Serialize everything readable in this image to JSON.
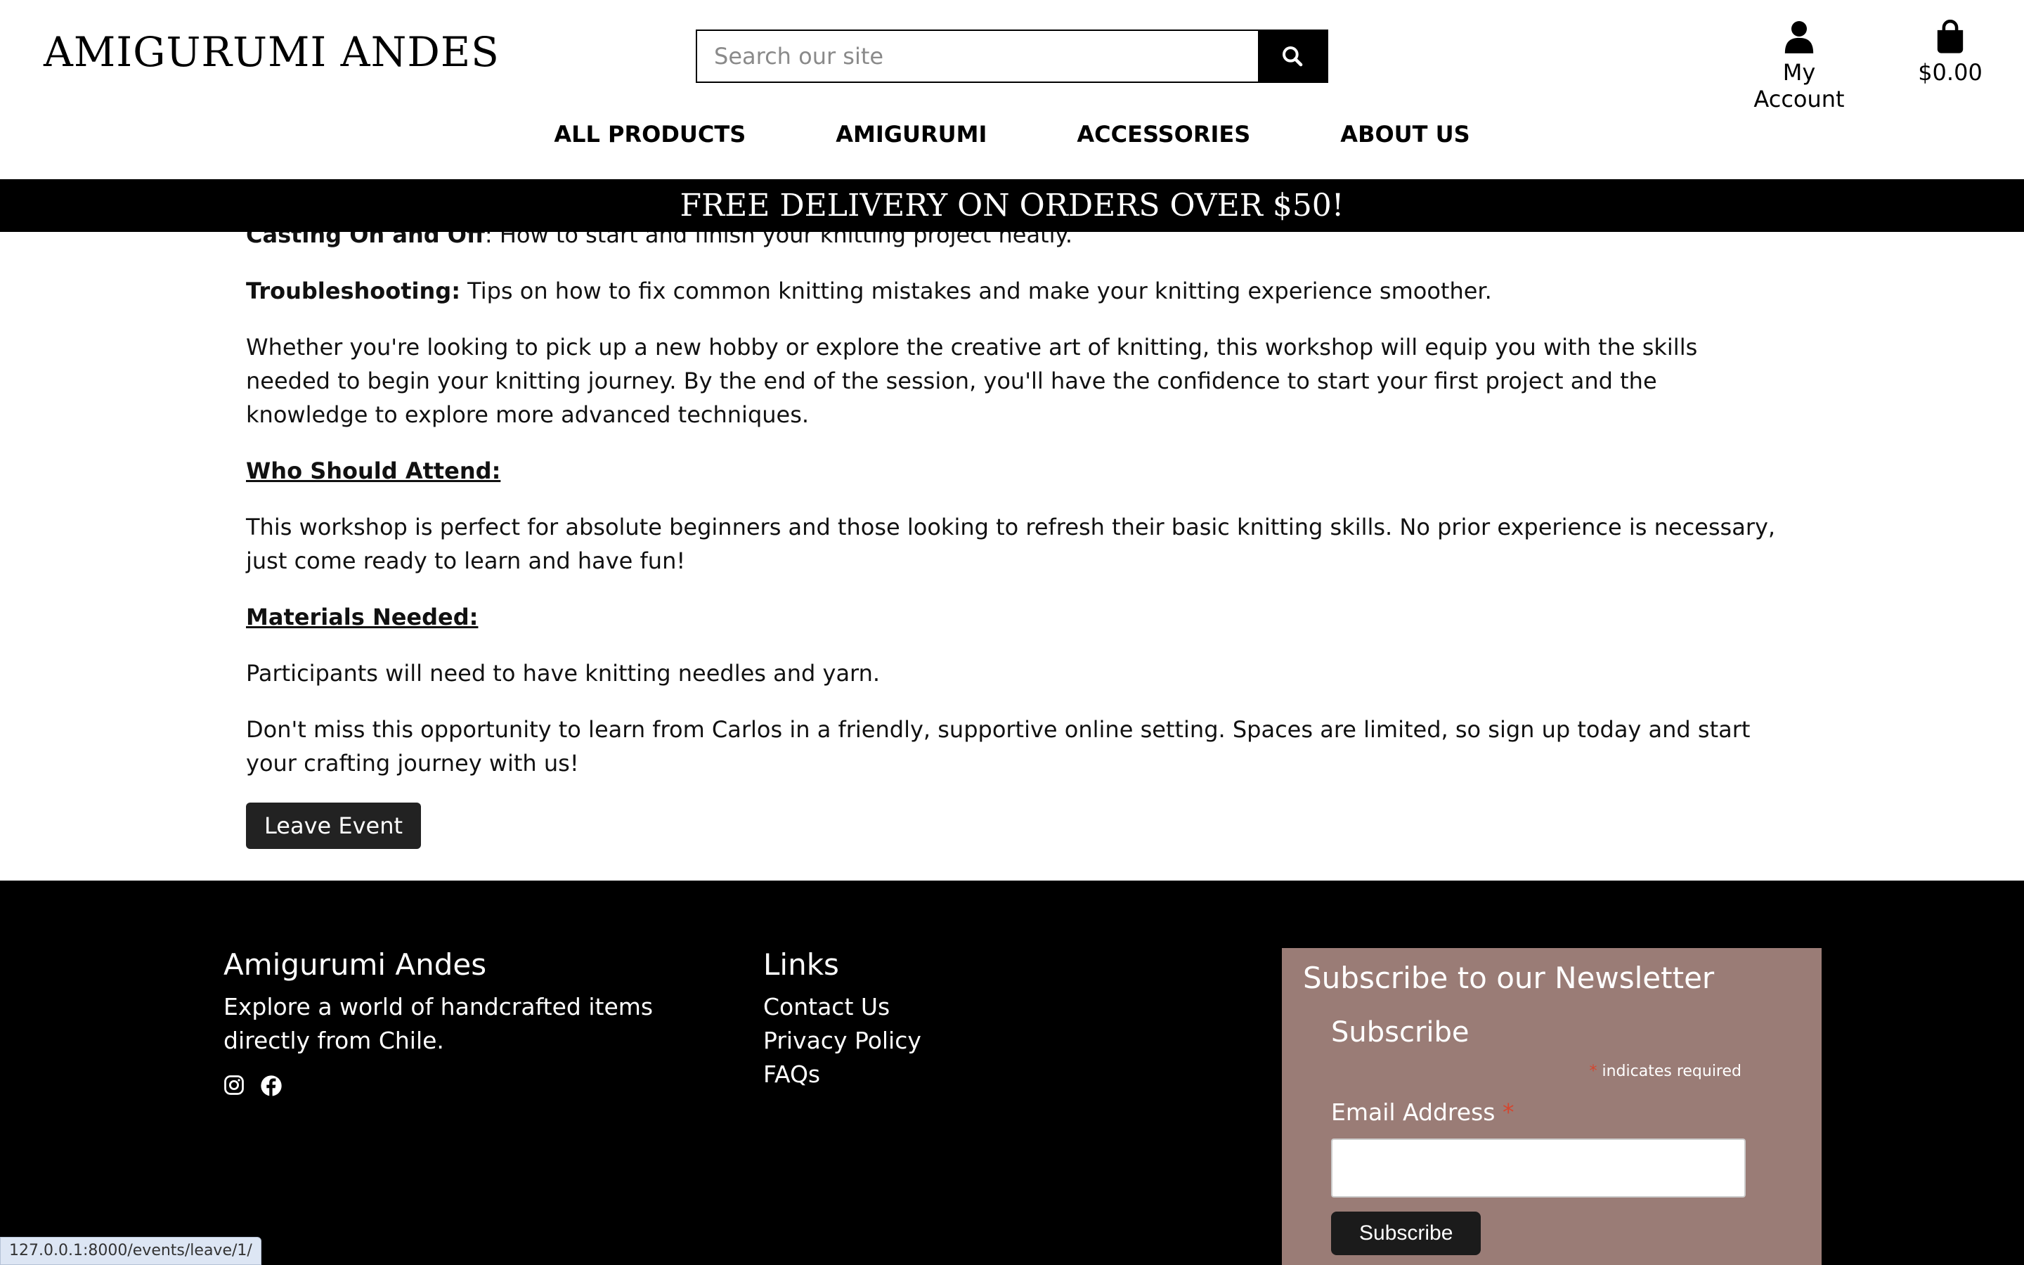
{
  "header": {
    "brand": "AMIGURUMI ANDES",
    "search_placeholder": "Search our site",
    "search_icon": "search-icon",
    "account_label": "My Account",
    "account_icon": "user-icon",
    "cart_total": "$0.00",
    "cart_icon": "shopping-bag-icon"
  },
  "nav": {
    "items": [
      "ALL PRODUCTS",
      "AMIGURUMI",
      "ACCESSORIES",
      "ABOUT US"
    ]
  },
  "banner": {
    "text": "FREE DELIVERY ON ORDERS OVER $50!"
  },
  "content": {
    "casting_bold": "Casting On and Off",
    "casting_rest": ": How to start and finish your knitting project neatly.",
    "troubleshooting_bold": "Troubleshooting:",
    "troubleshooting_rest": " Tips on how to fix common knitting mistakes and make your knitting experience smoother.",
    "paragraph_whether": "Whether you're looking to pick up a new hobby or explore the creative art of knitting, this workshop will equip you with the skills needed to begin your knitting journey. By the end of the session, you'll have the confidence to start your first project and the knowledge to explore more advanced techniques.",
    "who_heading": "Who Should Attend:",
    "who_text": "This workshop is perfect for absolute beginners and those looking to refresh their basic knitting skills. No prior experience is necessary, just come ready to learn and have fun!",
    "materials_heading": "Materials Needed:",
    "materials_text": "Participants will need to have knitting needles and yarn.",
    "closing_text": "Don't miss this opportunity to learn from Carlos in a friendly, supportive online setting. Spaces are limited, so sign up today and start your crafting journey with us!",
    "leave_button": "Leave Event"
  },
  "footer": {
    "brand_title": "Amigurumi Andes",
    "brand_desc": "Explore a world of handcrafted items directly from Chile.",
    "social_icons": [
      "instagram-icon",
      "facebook-icon"
    ],
    "links_title": "Links",
    "links": [
      "Contact Us",
      "Privacy Policy",
      "FAQs"
    ],
    "newsletter": {
      "title": "Subscribe to our Newsletter",
      "subtitle": "Subscribe",
      "required_asterisk": "*",
      "required_note": " indicates required",
      "email_label": "Email Address",
      "subscribe_button": "Subscribe",
      "accent_color": "#9a7c76"
    }
  },
  "statusbar": {
    "url": "127.0.0.1:8000/events/leave/1/"
  }
}
